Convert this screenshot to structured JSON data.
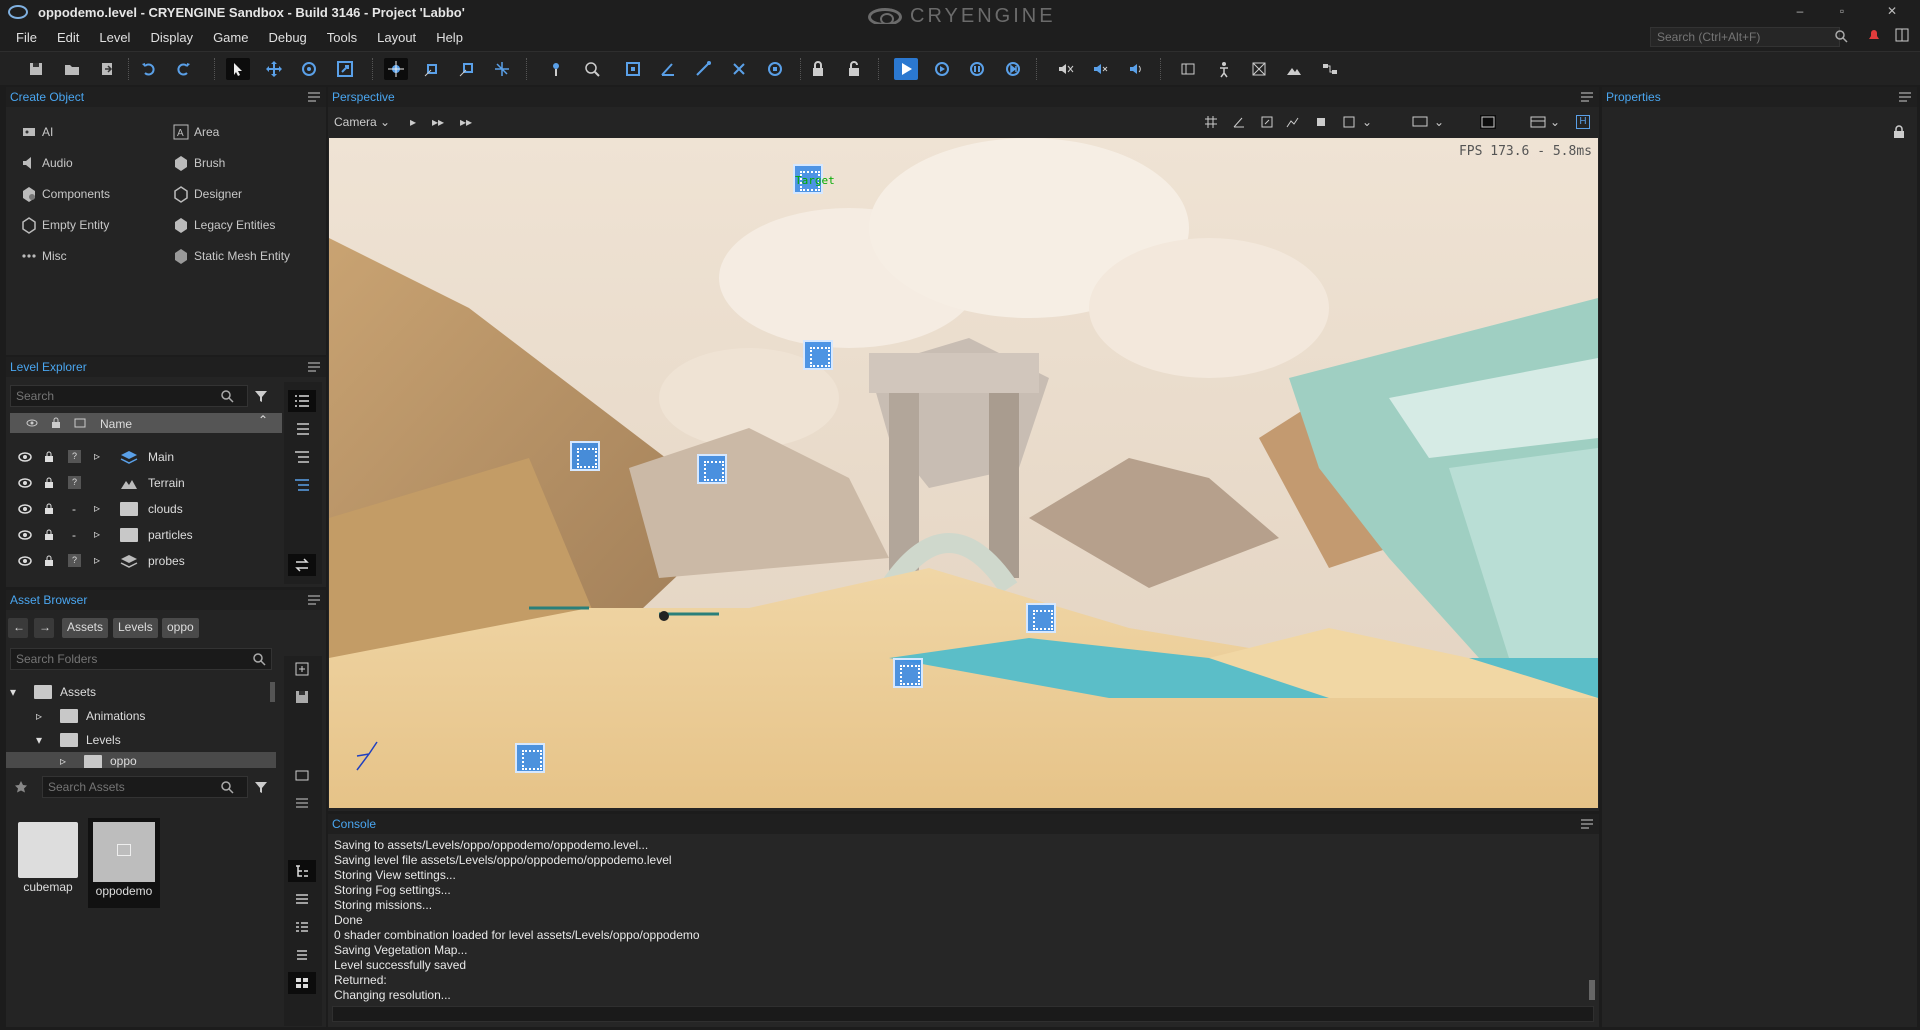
{
  "window": {
    "title": "oppodemo.level - CRYENGINE Sandbox - Build 3146 - Project 'Labbo'",
    "brand": "CRYENGINE",
    "min": "–",
    "max": "▫",
    "close": "✕"
  },
  "menu": [
    "File",
    "Edit",
    "Level",
    "Display",
    "Game",
    "Debug",
    "Tools",
    "Layout",
    "Help"
  ],
  "menu_search_placeholder": "Search (Ctrl+Alt+F)",
  "create_object": {
    "title": "Create Object",
    "items": [
      "AI",
      "Area",
      "Audio",
      "Brush",
      "Components",
      "Designer",
      "Empty Entity",
      "Legacy Entities",
      "Misc",
      "Static Mesh Entity"
    ]
  },
  "level_explorer": {
    "title": "Level Explorer",
    "search_placeholder": "Search",
    "column_name": "Name",
    "rows": [
      {
        "name": "Main",
        "q": "?"
      },
      {
        "name": "Terrain",
        "q": "?"
      },
      {
        "name": "clouds",
        "q": "-"
      },
      {
        "name": "particles",
        "q": "-"
      },
      {
        "name": "probes",
        "q": "?"
      }
    ]
  },
  "asset_browser": {
    "title": "Asset Browser",
    "crumbs": [
      "Assets",
      "Levels",
      "oppo"
    ],
    "search_folders_placeholder": "Search Folders",
    "tree": [
      "Assets",
      "Animations",
      "Levels",
      "oppo"
    ],
    "search_assets_placeholder": "Search Assets",
    "thumbs": [
      "cubemap",
      "oppodemo"
    ]
  },
  "perspective": {
    "title": "Perspective",
    "camera_label": "Camera",
    "fps": "FPS 173.6 - 5.8ms",
    "target_label": "Target"
  },
  "console": {
    "title": "Console",
    "lines": [
      "Saving to assets/Levels/oppo/oppodemo/oppodemo.level...",
      "Saving level file assets/Levels/oppo/oppodemo/oppodemo.level",
      "Storing View settings...",
      "Storing Fog settings...",
      "Storing missions...",
      "Done",
      "0 shader combination loaded for level assets/Levels/oppo/oppodemo",
      "Saving Vegetation Map...",
      "Level successfully saved",
      "Returned:",
      "Changing resolution..."
    ]
  },
  "properties": {
    "title": "Properties"
  },
  "colors": {
    "accent": "#4aa6f0",
    "active_tool": "#2b78d0",
    "sand": "#e8c894",
    "sky": "#efe3d4"
  },
  "icons": [
    "app-icon",
    "search-icon",
    "notification-icon",
    "layout-icon",
    "save-icon",
    "undo-icon",
    "redo-icon",
    "select-icon",
    "move-icon",
    "rotate-icon",
    "scale-icon",
    "lock-icon",
    "eye-icon",
    "filter-icon",
    "folder-icon",
    "play-icon"
  ]
}
